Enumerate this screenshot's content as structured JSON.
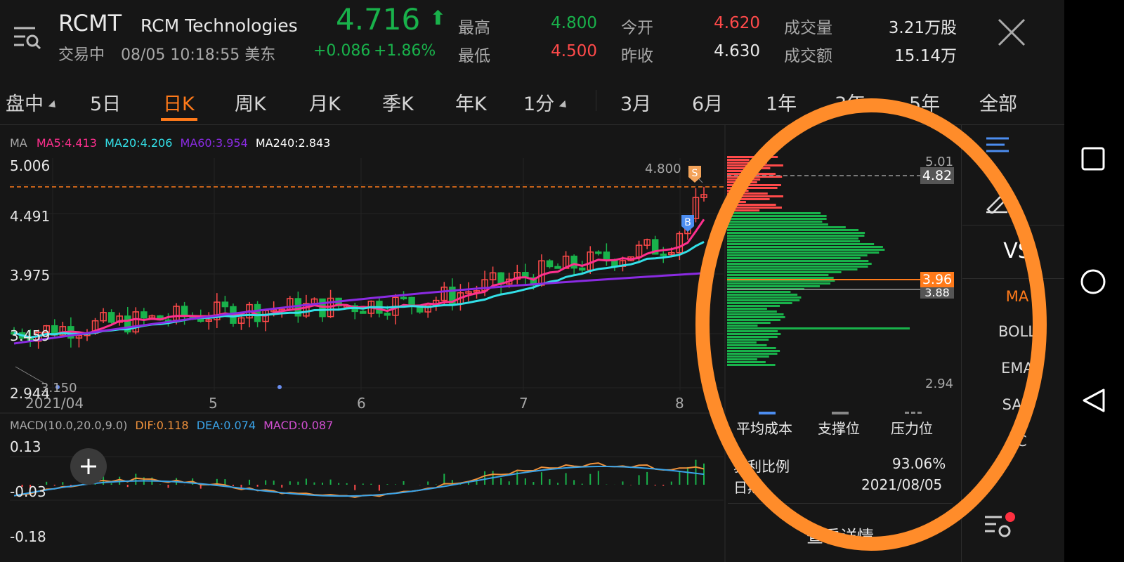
{
  "header": {
    "symbol": "RCMT",
    "company": "RCM Technologies",
    "price": "4.716",
    "status": "交易中",
    "time": "08/05 10:18:55 美东",
    "change": "+0.086",
    "change_pct": "+1.86%",
    "stats": [
      {
        "label": "最高",
        "value": "4.800",
        "color": "#19b24b"
      },
      {
        "label": "今开",
        "value": "4.620",
        "color": "#ff4a4a"
      },
      {
        "label": "成交量",
        "value": "3.21万股",
        "color": "#e8e8e8"
      },
      {
        "label": "最低",
        "value": "4.500",
        "color": "#ff4a4a"
      },
      {
        "label": "昨收",
        "value": "4.630",
        "color": "#e8e8e8"
      },
      {
        "label": "成交额",
        "value": "15.14万",
        "color": "#e8e8e8"
      }
    ]
  },
  "tabs": [
    "盘中",
    "5日",
    "日K",
    "周K",
    "月K",
    "季K",
    "年K",
    "1分",
    "3月",
    "6月",
    "1年",
    "3年",
    "5年",
    "全部"
  ],
  "active_tab": "日K",
  "ma_legend": {
    "label": "MA",
    "items": [
      {
        "text": "MA5:4.413",
        "color": "#ff2f8e"
      },
      {
        "text": "MA20:4.206",
        "color": "#33e0e8"
      },
      {
        "text": "MA60:3.954",
        "color": "#8a2be2"
      },
      {
        "text": "MA240:2.843",
        "color": "#ffffff"
      }
    ]
  },
  "price_axis": [
    "5.006",
    "4.491",
    "3.975",
    "3.459",
    "2.944"
  ],
  "price_annotations": {
    "high": "4.800",
    "low": "3.150",
    "sell_marker": "S",
    "buy_marker": "B"
  },
  "date_axis": [
    "2021/04",
    "5",
    "6",
    "7",
    "8"
  ],
  "macd": {
    "legend": "MACD(10.0,20.0,9.0)",
    "dif": "DIF:0.118",
    "dea": "DEA:0.074",
    "macd": "MACD:0.087",
    "axis": [
      "0.13",
      "-0.03",
      "-0.18"
    ]
  },
  "chips": {
    "top": "5.01",
    "bottom": "2.94",
    "pressure": "4.82",
    "avg_cost": "3.96",
    "support": "3.88",
    "legend": [
      "平均成本",
      "支撑位",
      "压力位"
    ],
    "profit_label": "获利比例",
    "profit_value": "93.06%",
    "date_label": "日期",
    "date_value": "2021/08/05",
    "detail": "查看详情"
  },
  "sidebar": {
    "items": [
      "VS",
      "MA",
      "BOLL",
      "EMA",
      "SAR",
      "KC"
    ]
  },
  "colors": {
    "up": "#ff4a4a",
    "down": "#19b24b",
    "accent": "#ff7a1a",
    "annotation_ring": "#ff8c2a"
  },
  "chart_data": {
    "type": "candlestick",
    "y_range": [
      2.944,
      5.006
    ],
    "x_axis_labels": [
      "2021/04",
      "5",
      "6",
      "7",
      "8"
    ],
    "last": {
      "open": 4.62,
      "high": 4.8,
      "low": 4.5,
      "close": 4.716
    },
    "ma_lines": [
      {
        "name": "MA5",
        "value": 4.413
      },
      {
        "name": "MA20",
        "value": 4.206
      },
      {
        "name": "MA60",
        "value": 3.954
      },
      {
        "name": "MA240",
        "value": 2.843
      }
    ],
    "macd": {
      "dif": 0.118,
      "dea": 0.074,
      "macd": 0.087
    }
  }
}
